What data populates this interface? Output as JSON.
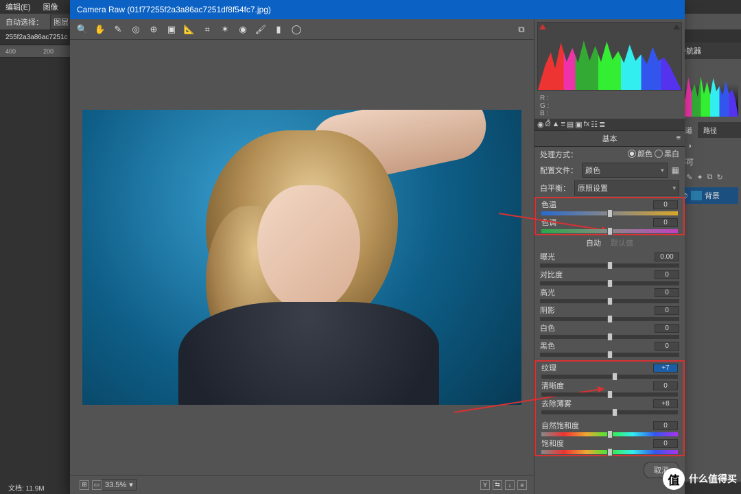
{
  "host": {
    "menu": {
      "edit": "编辑(E)",
      "image": "图像"
    },
    "options": {
      "auto_select": "自动选择：",
      "layer_combo": "图层"
    },
    "tab": "255f2a3a86ac7251c",
    "ruler": [
      "400",
      "200"
    ],
    "nav": {
      "title": "导航器"
    },
    "panels": {
      "channels": "通道",
      "paths": "路径",
      "unavail": "不可",
      "bg_layer": "背景"
    },
    "status": {
      "doc": "文档: 11.9M"
    }
  },
  "cr": {
    "title": "Camera Raw (01f77255f2a3a86ac7251df8f54fc7.jpg)",
    "rgb": {
      "r": "R :",
      "g": "G :",
      "b": "B :"
    },
    "basic_title": "基本",
    "treatment": {
      "label": "处理方式：",
      "color": "颜色",
      "bw": "黑白"
    },
    "profile": {
      "label": "配置文件：",
      "value": "颜色"
    },
    "wb": {
      "label": "白平衡：",
      "value": "原照设置"
    },
    "sliders": {
      "temp": {
        "label": "色温",
        "value": "0",
        "pos": 50
      },
      "tint": {
        "label": "色调",
        "value": "0",
        "pos": 50
      },
      "auto": "自动",
      "default": "默认值",
      "expo": {
        "label": "曝光",
        "value": "0.00",
        "pos": 50
      },
      "contr": {
        "label": "对比度",
        "value": "0",
        "pos": 50
      },
      "high": {
        "label": "高光",
        "value": "0",
        "pos": 50
      },
      "shad": {
        "label": "阴影",
        "value": "0",
        "pos": 50
      },
      "white": {
        "label": "白色",
        "value": "0",
        "pos": 50
      },
      "black": {
        "label": "黑色",
        "value": "0",
        "pos": 50
      },
      "text": {
        "label": "纹理",
        "value": "+7",
        "pos": 54
      },
      "clar": {
        "label": "清晰度",
        "value": "0",
        "pos": 50
      },
      "dehz": {
        "label": "去除薄雾",
        "value": "+8",
        "pos": 54
      },
      "vib": {
        "label": "自然饱和度",
        "value": "0",
        "pos": 50
      },
      "sat": {
        "label": "饱和度",
        "value": "0",
        "pos": 50
      }
    },
    "zoom": "33.5%",
    "buttons": {
      "cancel": "取消"
    }
  },
  "watermark": "什么值得买"
}
